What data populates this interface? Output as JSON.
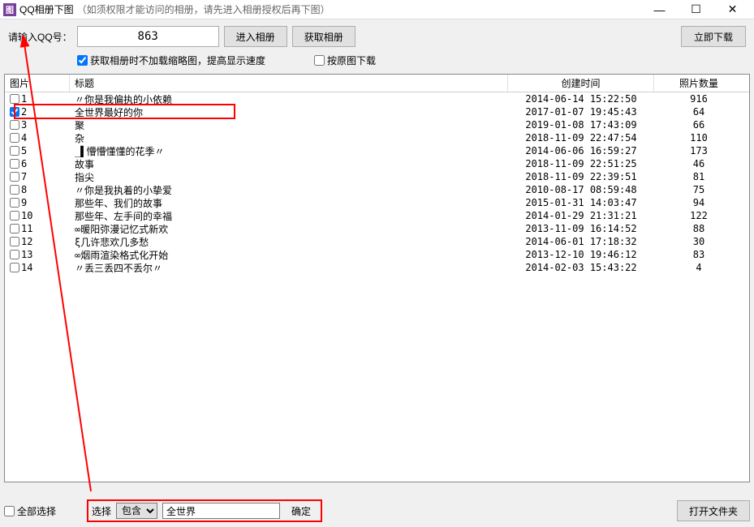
{
  "window": {
    "icon_text": "图",
    "title": "QQ相册下图",
    "note": "（如须权限才能访问的相册，请先进入相册授权后再下图）"
  },
  "toolbar": {
    "qq_label": "请输入QQ号：",
    "qq_value": "863",
    "enter_album": "进入相册",
    "get_album": "获取相册",
    "download_now": "立即下载"
  },
  "options": {
    "no_thumb": "获取相册时不加载缩略图，提高显示速度",
    "original": "按原图下载"
  },
  "columns": {
    "pic": "图片",
    "title": "标题",
    "time": "创建时间",
    "count": "照片数量"
  },
  "rows": [
    {
      "idx": "1",
      "checked": false,
      "title": "〃你是我偏执的小依赖",
      "time": "2014-06-14 15:22:50",
      "count": "916"
    },
    {
      "idx": "2",
      "checked": true,
      "title": "全世界最好的你",
      "time": "2017-01-07 19:45:43",
      "count": "64"
    },
    {
      "idx": "3",
      "checked": false,
      "title": "聚",
      "time": "2019-01-08 17:43:09",
      "count": "66"
    },
    {
      "idx": "4",
      "checked": false,
      "title": "杂",
      "time": "2018-11-09 22:47:54",
      "count": "110"
    },
    {
      "idx": "5",
      "checked": false,
      "title": "_▌懵懵懂懂的花季〃",
      "time": "2014-06-06 16:59:27",
      "count": "173"
    },
    {
      "idx": "6",
      "checked": false,
      "title": "故事",
      "time": "2018-11-09 22:51:25",
      "count": "46"
    },
    {
      "idx": "7",
      "checked": false,
      "title": "指尖",
      "time": "2018-11-09 22:39:51",
      "count": "81"
    },
    {
      "idx": "8",
      "checked": false,
      "title": "〃你是我执着的小挚爱",
      "time": "2010-08-17 08:59:48",
      "count": "75"
    },
    {
      "idx": "9",
      "checked": false,
      "title": "那些年、我们的故事",
      "time": "2015-01-31 14:03:47",
      "count": "94"
    },
    {
      "idx": "10",
      "checked": false,
      "title": "那些年、左手间的幸福",
      "time": "2014-01-29 21:31:21",
      "count": "122"
    },
    {
      "idx": "11",
      "checked": false,
      "title": "∞暖阳弥漫记忆式新欢",
      "time": "2013-11-09 16:14:52",
      "count": "88"
    },
    {
      "idx": "12",
      "checked": false,
      "title": "ξ几许悲欢几多愁",
      "time": "2014-06-01 17:18:32",
      "count": "30"
    },
    {
      "idx": "13",
      "checked": false,
      "title": "∞烟雨渲染格式化开始",
      "time": "2013-12-10 19:46:12",
      "count": "83"
    },
    {
      "idx": "14",
      "checked": false,
      "title": "〃丢三丢四不丢尔〃",
      "time": "2014-02-03 15:43:22",
      "count": "4"
    }
  ],
  "footer": {
    "select_all": "全部选择",
    "select_label": "选择",
    "filter_mode": "包含",
    "filter_value": "全世界",
    "confirm": "确定",
    "open_folder": "打开文件夹"
  }
}
